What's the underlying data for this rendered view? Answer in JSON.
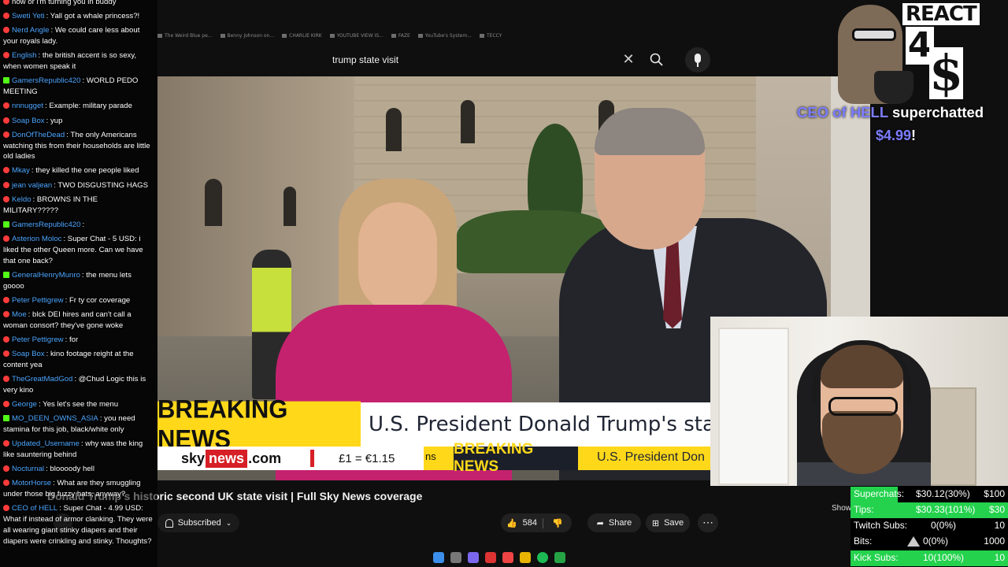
{
  "bookmarks": [
    "The Weird Blue pe...",
    "Benny Johnson on...",
    "CHARLIE KIRK",
    "YOUTUBE VIEW IS...",
    "FAZE",
    "YouTube's System...",
    "TECCY"
  ],
  "search": {
    "query": "trump state visit"
  },
  "video": {
    "breaking_label": "BREAKING NEWS",
    "headline": "U.S. President Donald Trump's state vis",
    "sky_pre": "sky",
    "sky_news": "news",
    "sky_post": ".com",
    "fx": "£1 = €1.15",
    "ticker_partial": "ns",
    "ticker_breaking": "BREAKING NEWS",
    "ticker_headline": "U.S. President Don"
  },
  "video_info": {
    "title": "Donald Trump's historic second UK state visit | Full Sky News coverage",
    "subscribed_label": "Subscribed",
    "likes": "584",
    "share_label": "Share",
    "save_label": "Save",
    "show_label": "Show"
  },
  "chat": [
    {
      "platform": "yt",
      "user": "",
      "text": "now or i'm turning you in buddy"
    },
    {
      "platform": "yt",
      "user": "Sweti Yeti",
      "text": "Yall got a whale princess?!"
    },
    {
      "platform": "yt",
      "user": "Nerd Angle",
      "text": "We could care less about your royals lady."
    },
    {
      "platform": "yt",
      "user": "English",
      "text": "the british accent is so sexy, when women speak it"
    },
    {
      "platform": "kick",
      "user": "GamersRepublic420",
      "text": "WORLD PEDO MEETING"
    },
    {
      "platform": "yt",
      "user": "nnnugget",
      "text": "Example: military parade"
    },
    {
      "platform": "yt",
      "user": "Soap Box",
      "text": "yup"
    },
    {
      "platform": "yt",
      "user": "DonOfTheDead",
      "text": "The only Americans watching this from their households are little old ladies"
    },
    {
      "platform": "yt",
      "user": "Mkay",
      "text": "they killed the one people liked"
    },
    {
      "platform": "yt",
      "user": "jean valjean",
      "text": "TWO DISGUSTING HAGS"
    },
    {
      "platform": "yt",
      "user": "Keldo",
      "text": "BROWNS IN THE MILITARY?????"
    },
    {
      "platform": "kick",
      "user": "GamersRepublic420",
      "text": ""
    },
    {
      "platform": "yt",
      "user": "Asterion Moloc",
      "text": "Super Chat - 5 USD: i liked the other Queen more. Can we have that one back?"
    },
    {
      "platform": "kick",
      "user": "GeneralHenryMunro",
      "text": "the menu lets goooo"
    },
    {
      "platform": "yt",
      "user": "Peter Pettigrew",
      "text": "Fr ty cor coverage"
    },
    {
      "platform": "yt",
      "user": "Moe",
      "text": "blck DEI hires and can't call a woman consort? they've gone woke"
    },
    {
      "platform": "yt",
      "user": "Peter Pettigrew",
      "text": "for"
    },
    {
      "platform": "yt",
      "user": "Soap Box",
      "text": "kino footage reight at the content yea"
    },
    {
      "platform": "yt",
      "user": "TheGreatMadGod",
      "text": "@Chud Logic this is very kino"
    },
    {
      "platform": "yt",
      "user": "George",
      "text": "Yes let's see the menu"
    },
    {
      "platform": "kick",
      "user": "MO_DEEN_OWNS_ASIA",
      "text": "you need stamina for this job, black/white only"
    },
    {
      "platform": "yt",
      "user": "Updated_Username",
      "text": "why was the king like sauntering behind"
    },
    {
      "platform": "yt",
      "user": "Nocturnal",
      "text": "bloooody hell"
    },
    {
      "platform": "yt",
      "user": "MotorHorse",
      "text": "What are they smuggling under those big fuzzy hats, anyway?"
    },
    {
      "platform": "yt",
      "user": "CEO of HELL",
      "text": "Super Chat - 4.99 USD: What if instead of armor clanking. They were all wearing giant stinky diapers and their diapers were crinkling and stinky. Thoughts?"
    }
  ],
  "react_sign": {
    "react": "REACT",
    "four": "4",
    "dollar": "$"
  },
  "alert": {
    "name": "CEO of HELL",
    "action": "superchatted",
    "amount": "$4.99",
    "bang": "!"
  },
  "stats": [
    {
      "label": "Superchats:",
      "pct": "$30.12(30%)",
      "goal": "$100",
      "fill": 0.3
    },
    {
      "label": "Tips:",
      "pct": "$30.33(101%)",
      "goal": "$30",
      "fill": 1.0
    },
    {
      "label": "Twitch Subs:",
      "pct": "0(0%)",
      "goal": "10",
      "fill": 0
    },
    {
      "label": "Bits:",
      "pct": "0(0%)",
      "goal": "1000",
      "fill": 0
    },
    {
      "label": "Kick Subs:",
      "pct": "10(100%)",
      "goal": "10",
      "fill": 1.0
    }
  ],
  "colors": {
    "youtube_red": "#ff3b3b",
    "kick_green": "#53fc18",
    "sky_yellow": "#ffd81a",
    "stat_green": "#24d24d",
    "alert_name": "#7c7dff"
  }
}
